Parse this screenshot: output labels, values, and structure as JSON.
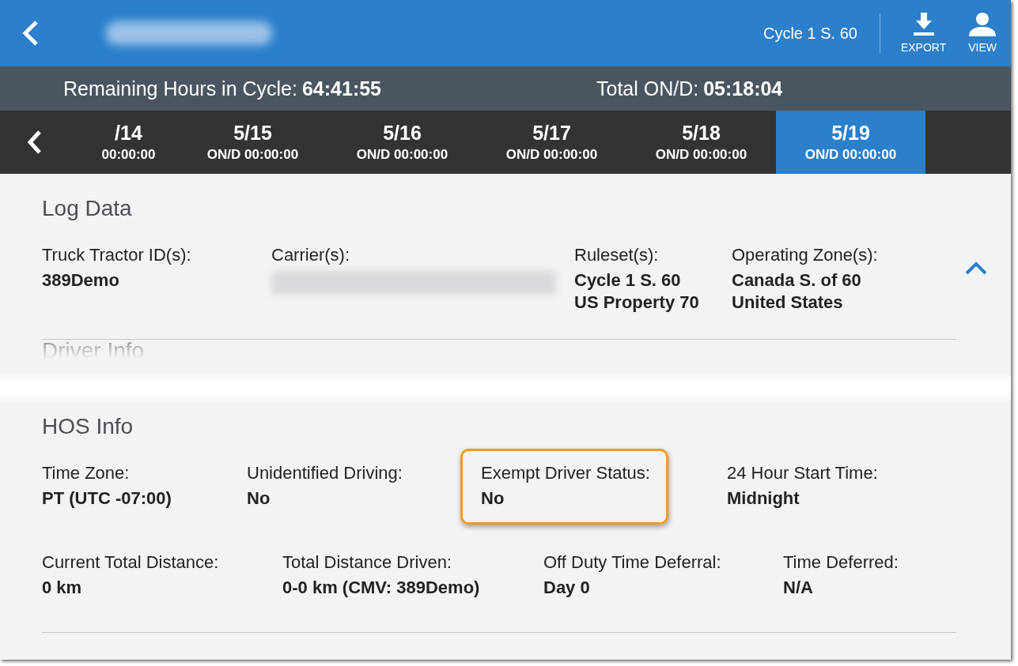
{
  "header": {
    "name_redacted": true,
    "ruleset": "Cycle 1 S. 60",
    "actions": [
      {
        "kind": "download",
        "label": "EXPORT"
      },
      {
        "kind": "person",
        "label": "VIEW"
      }
    ]
  },
  "summary": [
    {
      "label": "Remaining Hours in Cycle:",
      "value": "64:41:55"
    },
    {
      "label": "Total ON/D:",
      "value": "05:18:04"
    }
  ],
  "dates": [
    {
      "date": "/14",
      "status": "00:00:00",
      "selected": false
    },
    {
      "date": "5/15",
      "status": "ON/D 00:00:00",
      "selected": false
    },
    {
      "date": "5/16",
      "status": "ON/D 00:00:00",
      "selected": false
    },
    {
      "date": "5/17",
      "status": "ON/D 00:00:00",
      "selected": false
    },
    {
      "date": "5/18",
      "status": "ON/D 00:00:00",
      "selected": false
    },
    {
      "date": "5/19",
      "status": "ON/D 00:00:00",
      "selected": true
    }
  ],
  "sections": [
    {
      "title": "Log Data",
      "expanded": true,
      "rows": [
        [
          {
            "label": "Truck Tractor ID(s):",
            "values": [
              "389Demo"
            ],
            "highlighted": false
          },
          {
            "label": "Carrier(s):",
            "kind": "redacted",
            "highlighted": false
          },
          {
            "label": "Ruleset(s):",
            "values": [
              "Cycle 1 S. 60",
              "US Property 70"
            ],
            "highlighted": false
          },
          {
            "label": "Operating Zone(s):",
            "values": [
              "Canada S. of 60",
              "United States"
            ],
            "highlighted": false
          }
        ]
      ]
    },
    {
      "title": "Driver Info",
      "kind": "torn"
    },
    {
      "title": "HOS Info",
      "rows": [
        [
          {
            "label": "Time Zone:",
            "values": [
              "PT (UTC -07:00)"
            ],
            "highlighted": false
          },
          {
            "label": "Unidentified Driving:",
            "values": [
              "No"
            ],
            "highlighted": false
          },
          {
            "label": "Exempt Driver Status:",
            "values": [
              "No"
            ],
            "highlighted": true
          },
          {
            "label": "24 Hour Start Time:",
            "values": [
              "Midnight"
            ],
            "highlighted": false
          }
        ],
        [
          {
            "label": "Current Total Distance:",
            "values": [
              "0 km"
            ],
            "highlighted": false
          },
          {
            "label": "Total Distance Driven:",
            "values": [
              "0-0 km (CMV: 389Demo)"
            ],
            "highlighted": false
          },
          {
            "label": "Off Duty Time Deferral:",
            "values": [
              "Day 0"
            ],
            "highlighted": false
          },
          {
            "label": "Time Deferred:",
            "values": [
              "N/A"
            ],
            "highlighted": false
          }
        ]
      ]
    }
  ]
}
